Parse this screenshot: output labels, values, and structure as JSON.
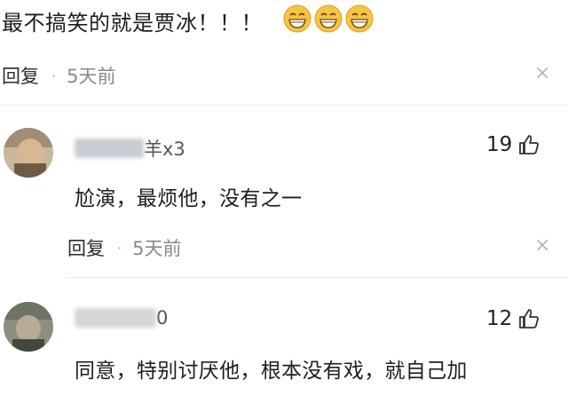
{
  "top_comment": {
    "text": "最不搞笑的就是贾冰！！！",
    "emojis": [
      "grin-emoji",
      "grin-emoji",
      "grin-emoji"
    ]
  },
  "meta_1": {
    "reply_label": "回复",
    "dot": "·",
    "time": "5天前",
    "close": "×"
  },
  "comments": [
    {
      "username_suffix": "羊x3",
      "likes": "19",
      "text": "尬演，最烦他，没有之一",
      "reply_label": "回复",
      "dot": "·",
      "time": "5天前",
      "close": "×"
    },
    {
      "username_suffix": "0",
      "likes": "12",
      "text": "同意，特别讨厌他，根本没有戏，就自己加"
    }
  ],
  "colors": {
    "text": "#1e1e1e",
    "secondary": "#8a8a8a",
    "emoji": "#f6c342"
  }
}
